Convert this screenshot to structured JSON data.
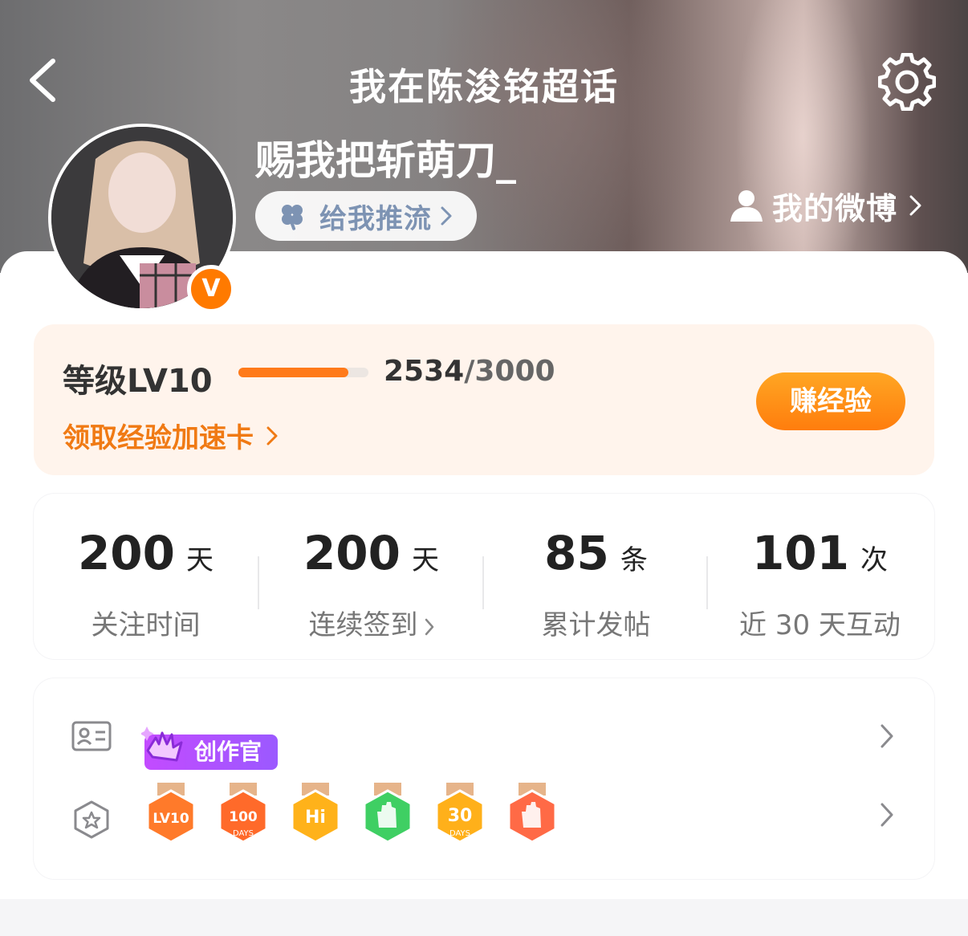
{
  "header": {
    "title": "我在陈浚铭超话",
    "back_icon": "chevron-left-icon",
    "settings_icon": "gear-icon"
  },
  "profile": {
    "username": "赐我把斩萌刀_",
    "verified_badge": "V",
    "push_button_label": "给我推流",
    "my_weibo_label": "我的微博"
  },
  "level": {
    "label_prefix": "等级",
    "level": "LV10",
    "current_exp": "2534",
    "total_exp": "/3000",
    "progress_fraction": 0.8447,
    "boost_link": "领取经验加速卡",
    "earn_button": "赚经验"
  },
  "stats": [
    {
      "value": "200",
      "unit": "天",
      "label": "关注时间",
      "has_arrow": false
    },
    {
      "value": "200",
      "unit": "天",
      "label": "连续签到",
      "has_arrow": true
    },
    {
      "value": "85",
      "unit": "条",
      "label": "累计发帖",
      "has_arrow": false
    },
    {
      "value": "101",
      "unit": "次",
      "label": "近 30 天互动",
      "has_arrow": false
    }
  ],
  "badges": {
    "creator_tag": "创作官",
    "medals": [
      {
        "name": "lv10-medal",
        "text": "LV10",
        "color": "#ff7a2a"
      },
      {
        "name": "100-days-medal",
        "text": "100",
        "sub": "DAYS",
        "color": "#ff6a2a"
      },
      {
        "name": "hi-medal",
        "text": "Hi",
        "color": "#ffb21a"
      },
      {
        "name": "hand-medal",
        "text": "",
        "color": "#3fcf63"
      },
      {
        "name": "30-days-medal",
        "text": "30",
        "sub": "DAYS",
        "color": "#ffb01a"
      },
      {
        "name": "rock-hand-medal",
        "text": "",
        "color": "#ff6a46"
      }
    ]
  },
  "colors": {
    "accent": "#ff7a00",
    "level_card_bg": "#fff4ec",
    "creator_tag": "#b14dff"
  }
}
